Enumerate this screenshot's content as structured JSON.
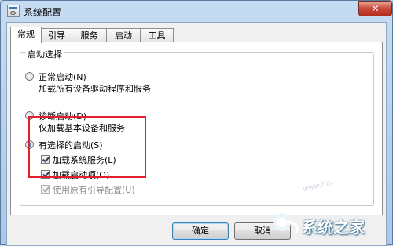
{
  "window": {
    "title": "系统配置",
    "close_label": "✕"
  },
  "tabs": [
    "常规",
    "引导",
    "服务",
    "启动",
    "工具"
  ],
  "general": {
    "group_title": "启动选择",
    "normal": {
      "label": "正常启动(N)",
      "desc": "加载所有设备驱动程序和服务",
      "selected": false
    },
    "diagnostic": {
      "label": "诊断启动(D)",
      "desc": "仅加载基本设备和服务",
      "selected": false
    },
    "selective": {
      "label": "有选择的启动(S)",
      "selected": true,
      "load_services": {
        "label": "加载系统服务(L)",
        "checked": true
      },
      "load_startup": {
        "label": "加载启动项(O)",
        "checked": true
      },
      "use_original_boot": {
        "label": "使用原有引导配置(U)",
        "checked": true,
        "disabled": true
      }
    }
  },
  "buttons": {
    "ok": "确定",
    "cancel": "取消"
  },
  "watermark": {
    "brand": "系统之家",
    "url": "www.ha..."
  },
  "colors": {
    "highlight": "#e0202b",
    "selection": "#1a5aa8"
  }
}
